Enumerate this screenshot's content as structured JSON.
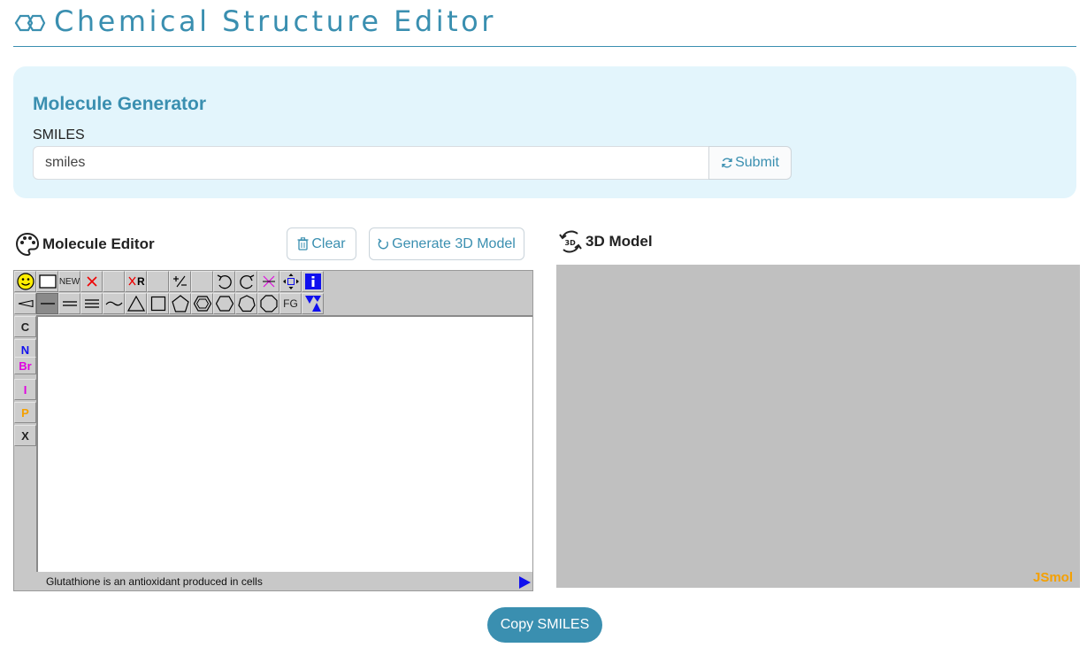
{
  "header": {
    "title": "Chemical Structure Editor",
    "logo_icon": "benzene-rings-icon"
  },
  "generator": {
    "title": "Molecule Generator",
    "smiles_label": "SMILES",
    "smiles_value": "smiles",
    "submit_label": "Submit",
    "submit_icon": "refresh-icon"
  },
  "editor": {
    "title": "Molecule Editor",
    "title_icon": "palette-icon",
    "clear_label": "Clear",
    "clear_icon": "trash-icon",
    "generate_label": "Generate 3D Model",
    "generate_icon": "refresh-icon",
    "toolbar": {
      "new_label": "NEW",
      "fg_label": "FG",
      "r_label": "R"
    },
    "atoms": [
      {
        "symbol": "C",
        "color": "#222222"
      },
      {
        "symbol": "N",
        "color": "#1010ee"
      },
      {
        "symbol": "Br",
        "color": "#e000e0"
      },
      {
        "symbol": "I",
        "color": "#e000e0"
      },
      {
        "symbol": "P",
        "color": "#f5a000"
      },
      {
        "symbol": "X",
        "color": "#222222"
      }
    ],
    "status_text": "Glutathione is an antioxidant produced in cells"
  },
  "model": {
    "title": "3D Model",
    "title_icon": "rotate-3d-icon",
    "watermark": "JSmol"
  },
  "copy_label": "Copy SMILES",
  "colors": {
    "accent": "#3a8fb0",
    "panel_bg": "#e3f5fc",
    "viewer_bg": "#c0c0c0",
    "jsmol": "#f5a000"
  }
}
